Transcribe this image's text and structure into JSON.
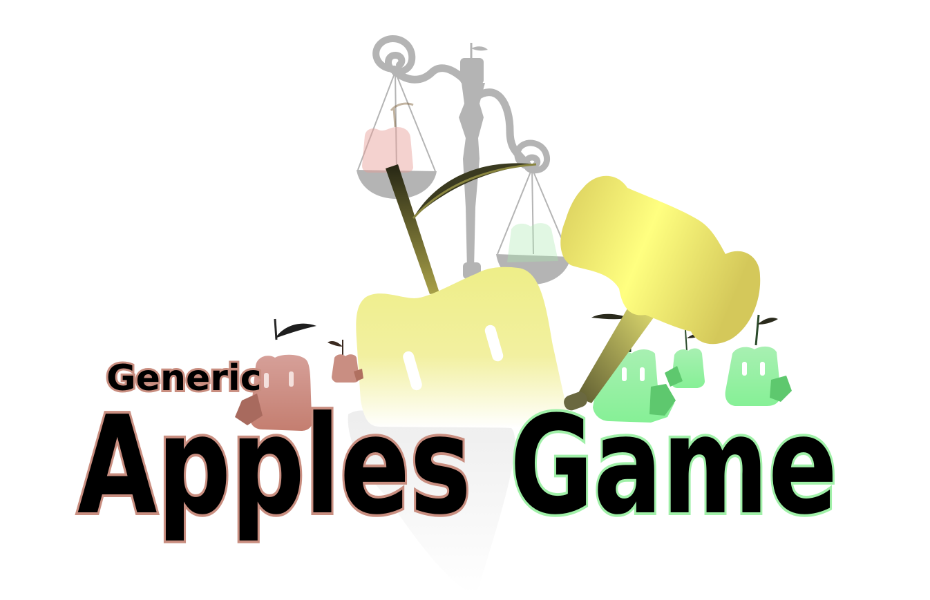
{
  "logo": {
    "subtitle": "Generic",
    "title_word_1": "Apples",
    "title_word_2": "Game"
  },
  "colors": {
    "red_apple": "#c97e70",
    "yellow_apple": "#eeee88",
    "green_apple": "#8ff59c",
    "scales_gray": "#b4b4b4",
    "gavel_gold": "#e8e070",
    "stem_dark": "#3a3a20",
    "text_fill": "#000000",
    "red_outline": "#c98e80",
    "yellow_outline": "#f0f0a0",
    "green_outline": "#a0f0a8"
  }
}
